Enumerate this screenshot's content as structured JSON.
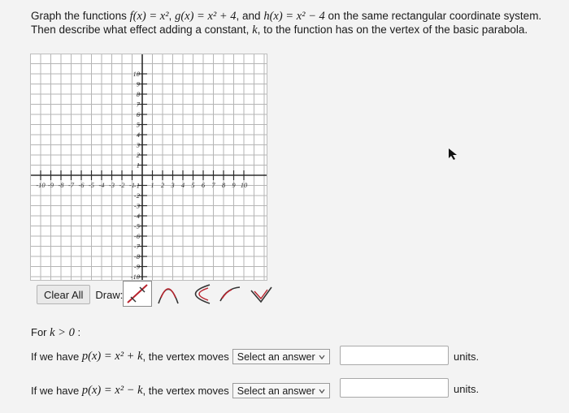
{
  "question": {
    "p1": "Graph the functions",
    "f_def": "f(x) = x²",
    "g_def": "g(x) = x² + 4",
    "and_word": "and",
    "h_def": "h(x) = x² − 4",
    "p2": "on the same rectangular coordinate system. Then describe what effect adding a constant,",
    "k": "k",
    "p3": ", to the function has on the vertex of the basic parabola."
  },
  "graph": {
    "x_ticks_neg": [
      "-10",
      "-9",
      "-8",
      "-7",
      "-6",
      "-5",
      "-4",
      "-3",
      "-2",
      "-1"
    ],
    "x_ticks_pos": [
      "1",
      "2",
      "3",
      "4",
      "5",
      "6",
      "7",
      "8",
      "9",
      "10"
    ],
    "y_ticks_pos": [
      "10",
      "9",
      "8",
      "7",
      "6",
      "5",
      "4",
      "3",
      "2",
      "1"
    ],
    "y_ticks_neg": [
      "-1",
      "-2",
      "-3",
      "-4",
      "-5",
      "-6",
      "-7",
      "-8",
      "-9",
      "-10"
    ]
  },
  "controls": {
    "clear_all": "Clear All",
    "draw_label": "Draw:"
  },
  "tools": [
    "line-tool-icon",
    "parabola-up-tool-icon",
    "parabola-left-tool-icon",
    "arc-tool-icon",
    "check-v-tool-icon"
  ],
  "condition": {
    "prefix": "For",
    "expr": "k > 0",
    "suffix": ":"
  },
  "rows": [
    {
      "prefix": "If we have",
      "func": "p(x) = x² + k",
      "mid": ", the vertex moves",
      "select": "Select an answer",
      "value": "",
      "units": "units."
    },
    {
      "prefix": "If we have",
      "func": "p(x) = x² − k",
      "mid": ", the vertex moves",
      "select": "Select an answer",
      "value": "",
      "units": "units."
    }
  ],
  "colors": {
    "accent": "#b8232d",
    "grid": "#b5b5b5",
    "axis": "#2b2b2b"
  }
}
